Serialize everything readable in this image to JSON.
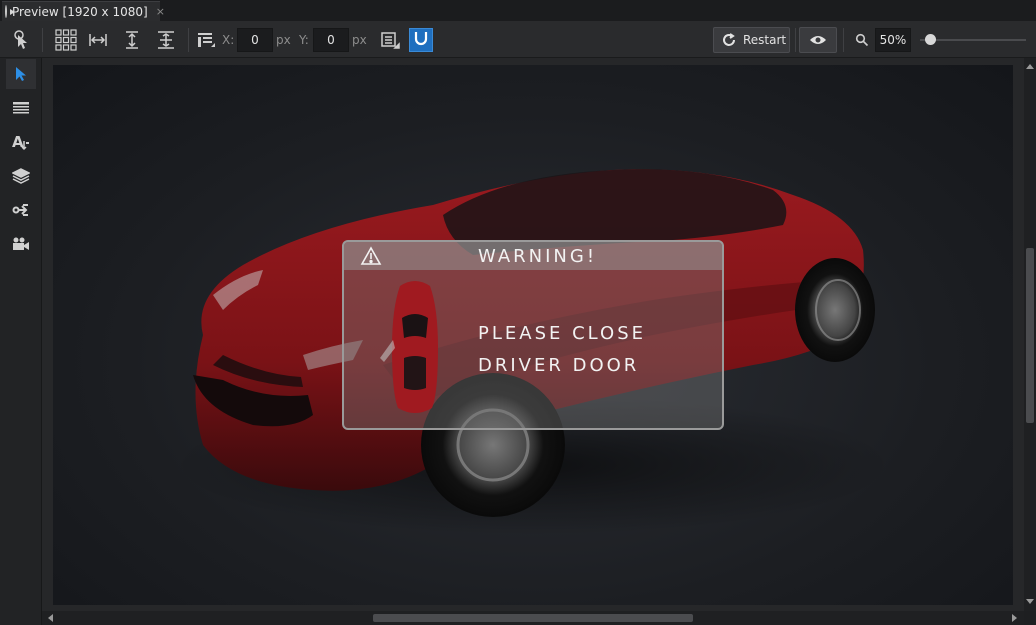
{
  "tab": {
    "title": "Preview [1920 x 1080]",
    "close": "×"
  },
  "toolbar": {
    "x_label": "X:",
    "x_value": "0",
    "x_unit": "px",
    "y_label": "Y:",
    "y_value": "0",
    "y_unit": "px",
    "restart_label": "Restart",
    "zoom_value": "50%",
    "zoom_level": 0.1
  },
  "icons": {
    "pointer": "pointer-hand-icon",
    "grid": "grid-icon",
    "fit_width": "fit-width-icon",
    "fit_height": "fit-height-icon",
    "fit_both": "fit-both-icon",
    "align": "align-icon",
    "layout": "layout-icon",
    "magnet": "magnet-icon",
    "restart": "restart-icon",
    "eye": "eye-icon",
    "zoom": "zoom-icon"
  },
  "sidebar": [
    "select-arrow-icon",
    "table-icon",
    "text-style-icon",
    "layers-icon",
    "connect-icon",
    "camera-icon"
  ],
  "dialog": {
    "title": "WARNING!",
    "line1": "PLEASE CLOSE",
    "line2": "DRIVER DOOR"
  },
  "colors": {
    "accent": "#1f6fbf",
    "car": "#8e1418"
  }
}
